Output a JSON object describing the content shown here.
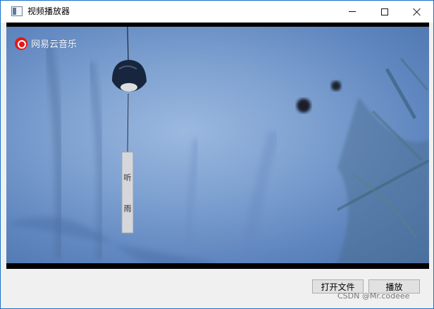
{
  "window": {
    "title": "视频播放器",
    "controls": [
      "minimize",
      "maximize",
      "close"
    ]
  },
  "video": {
    "watermark_logo": "netease-music-icon",
    "watermark_text": "网易云音乐",
    "subtitle_card": "听雨"
  },
  "toolbar": {
    "open_file_label": "打开文件",
    "play_label": "播放"
  },
  "footer": {
    "credit": "CSDN @Mr.codeee"
  },
  "colors": {
    "window_border": "#1a73c9",
    "video_sky": "#7fa2d1",
    "logo_red": "#e21918"
  }
}
